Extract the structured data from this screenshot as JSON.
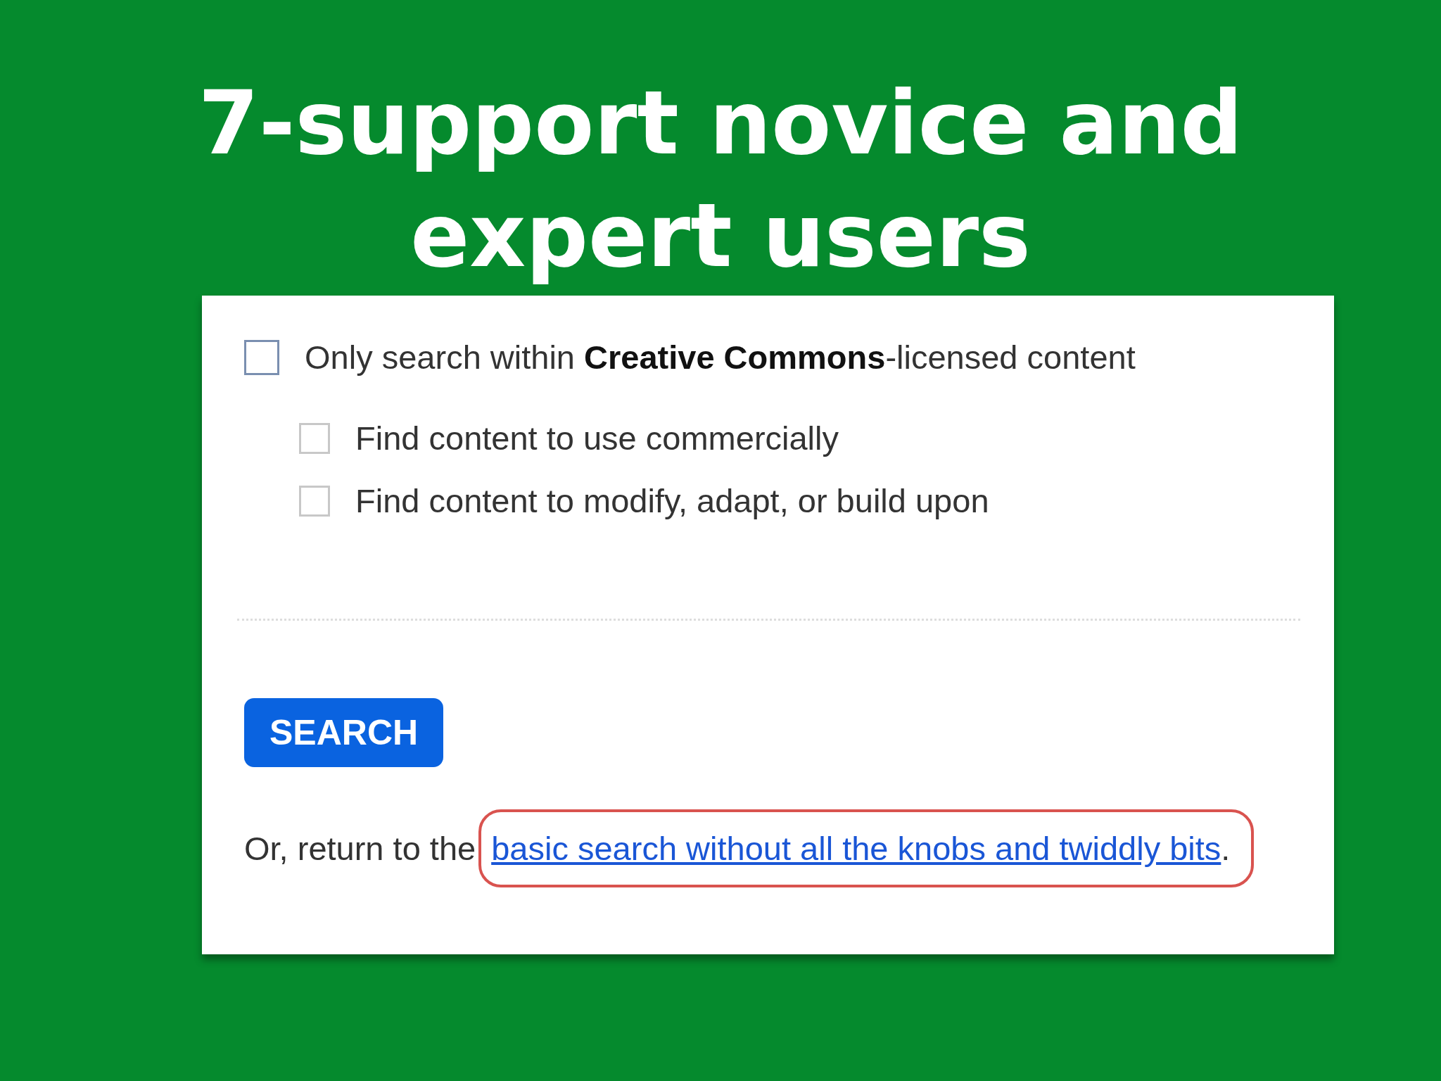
{
  "title_lines": [
    "7-support novice and",
    "expert users"
  ],
  "options": [
    {
      "kind": "main",
      "label": "Only search within **Creative Commons**-licensed content",
      "checked": false
    },
    {
      "kind": "sub",
      "label": "Find content to use commercially",
      "checked": false
    },
    {
      "kind": "sub",
      "label": "Find content to modify, adapt, or build upon",
      "checked": false
    }
  ],
  "search_button": "SEARCH",
  "footer": {
    "text": "Or, return to the",
    "link": "basic search without all the knobs and twiddly bits",
    "after": "."
  }
}
